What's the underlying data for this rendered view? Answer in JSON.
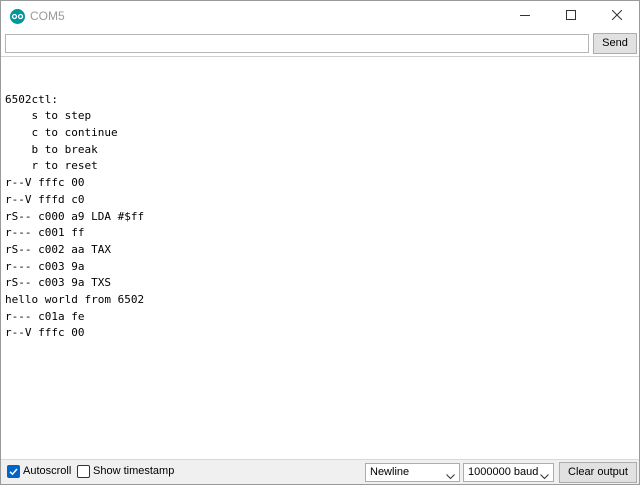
{
  "window": {
    "title": "COM5"
  },
  "send": {
    "input_value": "",
    "button_label": "Send"
  },
  "output": {
    "lines": [
      "",
      "6502ctl:",
      "    s to step",
      "    c to continue",
      "    b to break",
      "    r to reset",
      "r--V fffc 00",
      "r--V fffd c0",
      "rS-- c000 a9 LDA #$ff",
      "r--- c001 ff",
      "rS-- c002 aa TAX",
      "r--- c003 9a",
      "rS-- c003 9a TXS",
      "hello world from 6502",
      "r--- c01a fe",
      "r--V fffc 00"
    ]
  },
  "bottom": {
    "autoscroll_label": "Autoscroll",
    "autoscroll_checked": true,
    "timestamp_label": "Show timestamp",
    "timestamp_checked": false,
    "line_ending": "Newline",
    "baud_rate": "1000000 baud",
    "clear_label": "Clear output"
  },
  "colors": {
    "accent": "#0064c8",
    "app_icon": "#00979c",
    "title_text": "#999999"
  },
  "icons": {
    "app": "arduino-logo-icon",
    "minimize": "minimize-icon",
    "maximize": "maximize-icon",
    "close": "close-icon",
    "check": "checkmark-icon",
    "dropdown": "chevron-down-icon"
  }
}
